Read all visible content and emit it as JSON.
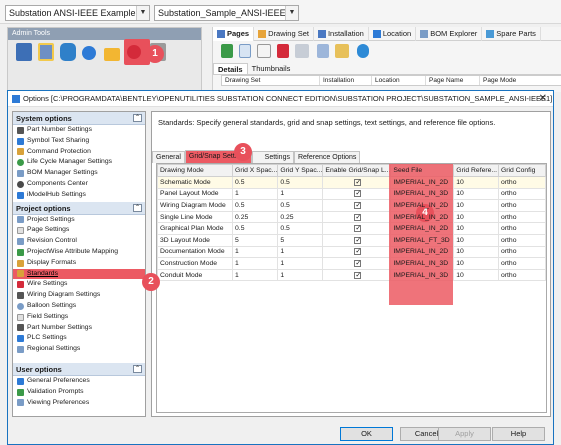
{
  "top": {
    "project_combo": "Substation ANSI-IEEE Example",
    "sample_combo": "Substation_Sample_ANSI-IEEE"
  },
  "admin": {
    "title": "Admin Tools",
    "icons": [
      "book-icon",
      "list-icon",
      "database-icon",
      "gear-group-icon",
      "briefcase-icon",
      "cog-icon",
      "wrench-icon"
    ]
  },
  "right_pane": {
    "tabs": [
      "Pages",
      "Drawing Set",
      "Installation",
      "Location",
      "BOM Explorer",
      "Spare Parts"
    ],
    "subtabs": [
      "Details",
      "Thumbnails"
    ],
    "columns": [
      "Drawing Set",
      "Installation",
      "Location",
      "Page Name",
      "Page Mode"
    ]
  },
  "dialog": {
    "title": "Options [C:\\PROGRAMDATA\\BENTLEY\\OPENUTILITIES SUBSTATION CONNECT EDITION\\SUBSTATION PROJECT\\SUBSTATION_SAMPLE_ANSI-IEEE1]",
    "system_options": {
      "header": "System options",
      "items": [
        "Part Number Settings",
        "Symbol Text Sharing",
        "Command Protection",
        "Life Cycle Manager Settings",
        "BOM Manager Settings",
        "Components Center",
        "iModelHub Settings"
      ]
    },
    "project_options": {
      "header": "Project options",
      "items": [
        "Project Settings",
        "Page Settings",
        "Revision Control",
        "ProjectWise Attribute Mapping",
        "Display Formats",
        "Standards",
        "Wire Settings",
        "Wiring Diagram Settings",
        "Balloon Settings",
        "Field Settings",
        "Part Number Settings",
        "PLC Settings",
        "Regional Settings"
      ]
    },
    "user_options": {
      "header": "User options",
      "items": [
        "General Preferences",
        "Validation Prompts",
        "Viewing Preferences"
      ]
    },
    "description": "Standards: Specify general standards, grid and snap settings, text settings, and reference file options.",
    "tabs": [
      "General",
      "Grid/Snap Settings",
      "Settings",
      "Reference Options"
    ],
    "grid": {
      "columns": [
        "Drawing Mode",
        "Grid X Spac...",
        "Grid Y Spac...",
        "Enable Grid/Snap L...",
        "Seed File",
        "Grid Refere...",
        "Grid Config"
      ],
      "rows": [
        [
          "Schematic Mode",
          "0.5",
          "0.5",
          "✓",
          "IMPERIAL_IN_2D",
          "10",
          "ortho"
        ],
        [
          "Panel Layout Mode",
          "1",
          "1",
          "✓",
          "IMPERIAL_IN_3D",
          "10",
          "ortho"
        ],
        [
          "Wiring Diagram Mode",
          "0.5",
          "0.5",
          "✓",
          "IMPERIAL_IN_2D",
          "10",
          "ortho"
        ],
        [
          "Single Line Mode",
          "0.25",
          "0.25",
          "✓",
          "IMPERIAL_IN_2D",
          "10",
          "ortho"
        ],
        [
          "Graphical Plan Mode",
          "0.5",
          "0.5",
          "✓",
          "IMPERIAL_IN_2D",
          "10",
          "ortho"
        ],
        [
          "3D Layout Mode",
          "5",
          "5",
          "✓",
          "IMPERIAL_FT_3D",
          "10",
          "ortho"
        ],
        [
          "Documentation Mode",
          "1",
          "1",
          "✓",
          "IMPERIAL_IN_2D",
          "10",
          "ortho"
        ],
        [
          "Construction Mode",
          "1",
          "1",
          "✓",
          "IMPERIAL_IN_3D",
          "10",
          "ortho"
        ],
        [
          "Conduit Mode",
          "1",
          "1",
          "✓",
          "IMPERIAL_IN_3D",
          "10",
          "ortho"
        ]
      ]
    },
    "buttons": {
      "ok": "OK",
      "cancel": "Cancel",
      "apply": "Apply",
      "help": "Help"
    }
  },
  "badges": [
    "1",
    "2",
    "3",
    "4"
  ],
  "colors": {
    "highlight": "#e8505b",
    "section": "#dbe5f1",
    "accent": "#1973c0"
  }
}
